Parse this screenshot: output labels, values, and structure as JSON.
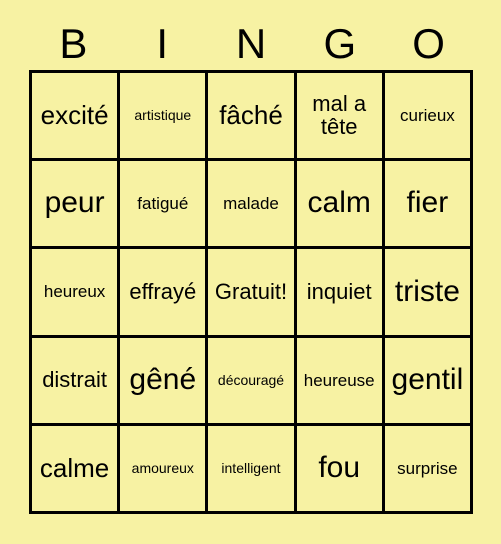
{
  "card": {
    "title": "BINGO",
    "header_letters": [
      "B",
      "I",
      "N",
      "G",
      "O"
    ],
    "background_color": "#f7f2a3",
    "border_color": "#000000",
    "text_color": "#000000",
    "rows": 5,
    "columns": 5,
    "free_space_label": "Gratuit!",
    "free_space_position": "row 3, column 3",
    "cells": [
      [
        {
          "text": "excité",
          "size": "lg"
        },
        {
          "text": "artistique",
          "size": "xs"
        },
        {
          "text": "fâché",
          "size": "lg"
        },
        {
          "text": "mal a tête",
          "size": "md"
        },
        {
          "text": "curieux",
          "size": "sm"
        }
      ],
      [
        {
          "text": "peur",
          "size": "xl"
        },
        {
          "text": "fatigué",
          "size": "sm"
        },
        {
          "text": "malade",
          "size": "sm"
        },
        {
          "text": "calm",
          "size": "xl"
        },
        {
          "text": "fier",
          "size": "xl"
        }
      ],
      [
        {
          "text": "heureux",
          "size": "sm"
        },
        {
          "text": "effrayé",
          "size": "md"
        },
        {
          "text": "Gratuit!",
          "size": "md"
        },
        {
          "text": "inquiet",
          "size": "md"
        },
        {
          "text": "triste",
          "size": "xl"
        }
      ],
      [
        {
          "text": "distrait",
          "size": "md"
        },
        {
          "text": "gêné",
          "size": "xl"
        },
        {
          "text": "découragé",
          "size": "xs"
        },
        {
          "text": "heureuse",
          "size": "sm"
        },
        {
          "text": "gentil",
          "size": "xl"
        }
      ],
      [
        {
          "text": "calme",
          "size": "lg"
        },
        {
          "text": "amoureux",
          "size": "xs"
        },
        {
          "text": "intelligent",
          "size": "xs"
        },
        {
          "text": "fou",
          "size": "xl"
        },
        {
          "text": "surprise",
          "size": "sm"
        }
      ]
    ]
  }
}
